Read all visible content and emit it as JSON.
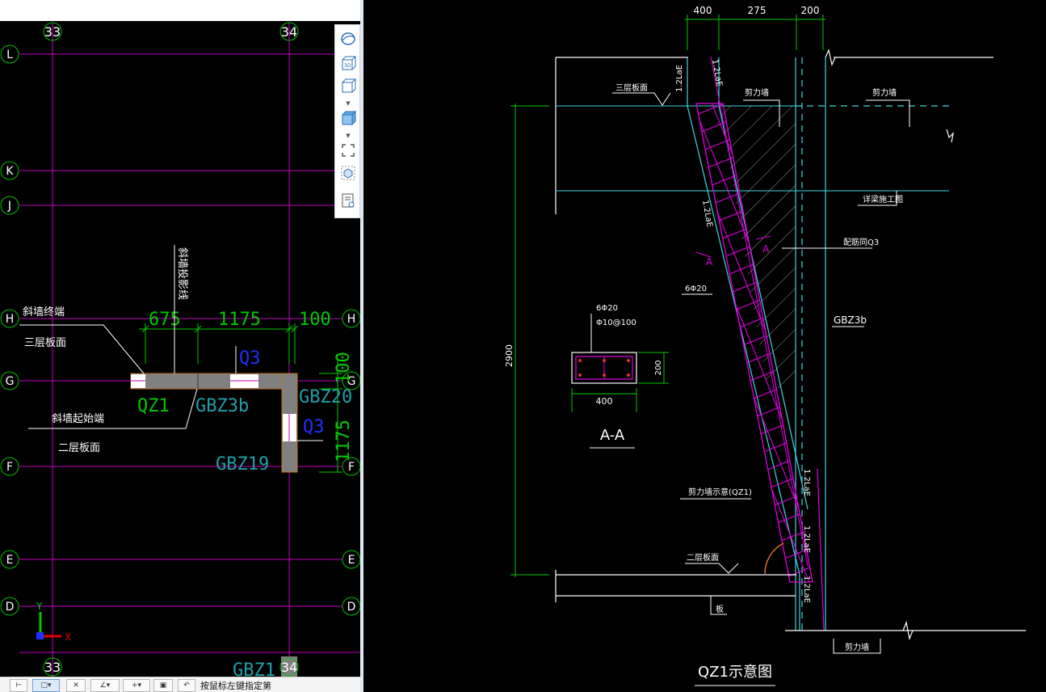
{
  "left_view": {
    "axis_columns": [
      "33",
      "34"
    ],
    "axis_rows": [
      "L",
      "K",
      "J",
      "H",
      "G",
      "F",
      "E",
      "D"
    ],
    "dims_top": [
      "675",
      "1175",
      "100"
    ],
    "dims_right": [
      "100",
      "1175"
    ],
    "labels": {
      "projection": "斜墙投影线",
      "end": "斜墙终端",
      "end_floor": "三层板面",
      "start": "斜墙起始端",
      "start_floor": "二层板面"
    },
    "components": {
      "qz1": "QZ1",
      "gbz3b": "GBZ3b",
      "q3_top": "Q3",
      "gbz20": "GBZ20",
      "q3_right": "Q3",
      "gbz19": "GBZ19",
      "gbz_bottom": "GBZ1"
    },
    "ucs": {
      "x": "X",
      "y": "Y"
    }
  },
  "status_bar": {
    "hint": "按鼠标左键指定第"
  },
  "detail": {
    "top_dims": [
      "400",
      "275",
      "200"
    ],
    "height_dim": "2900",
    "labels": {
      "third_floor": "三层板面",
      "shear_wall_1": "剪力墙",
      "shear_wall_2": "剪力墙",
      "lap_top": "1.2LaE",
      "lap_top2": "1.2LaE",
      "lap_mid": "1.2LaE",
      "beam_ref": "详梁施工图",
      "rebar_ref": "配筋同Q3",
      "section_a1": "A",
      "section_a2": "A",
      "bars": "6Φ20",
      "gbz": "GBZ3b",
      "shear_wall_note": "剪力墙示意(QZ1)",
      "lap_b1": "1.2LaE",
      "lap_b2": "1.2LaE",
      "lap_b3": "1.2LaE",
      "second_floor": "二层板面",
      "slab": "板",
      "shear_wall_bottom": "剪力墙",
      "caption": "QZ1示意图"
    },
    "section": {
      "bars": "6Φ20",
      "stirrups": "Φ10@100",
      "height": "200",
      "width": "400",
      "title": "A-A"
    }
  },
  "colors": {
    "grid": "#c000c0",
    "axis_bubble": "#00c000",
    "dim": "#00c800",
    "cyan": "#3fd6e0",
    "magenta": "#e000e0",
    "wall_fill": "#808080",
    "wall_outline": "#c07020"
  }
}
